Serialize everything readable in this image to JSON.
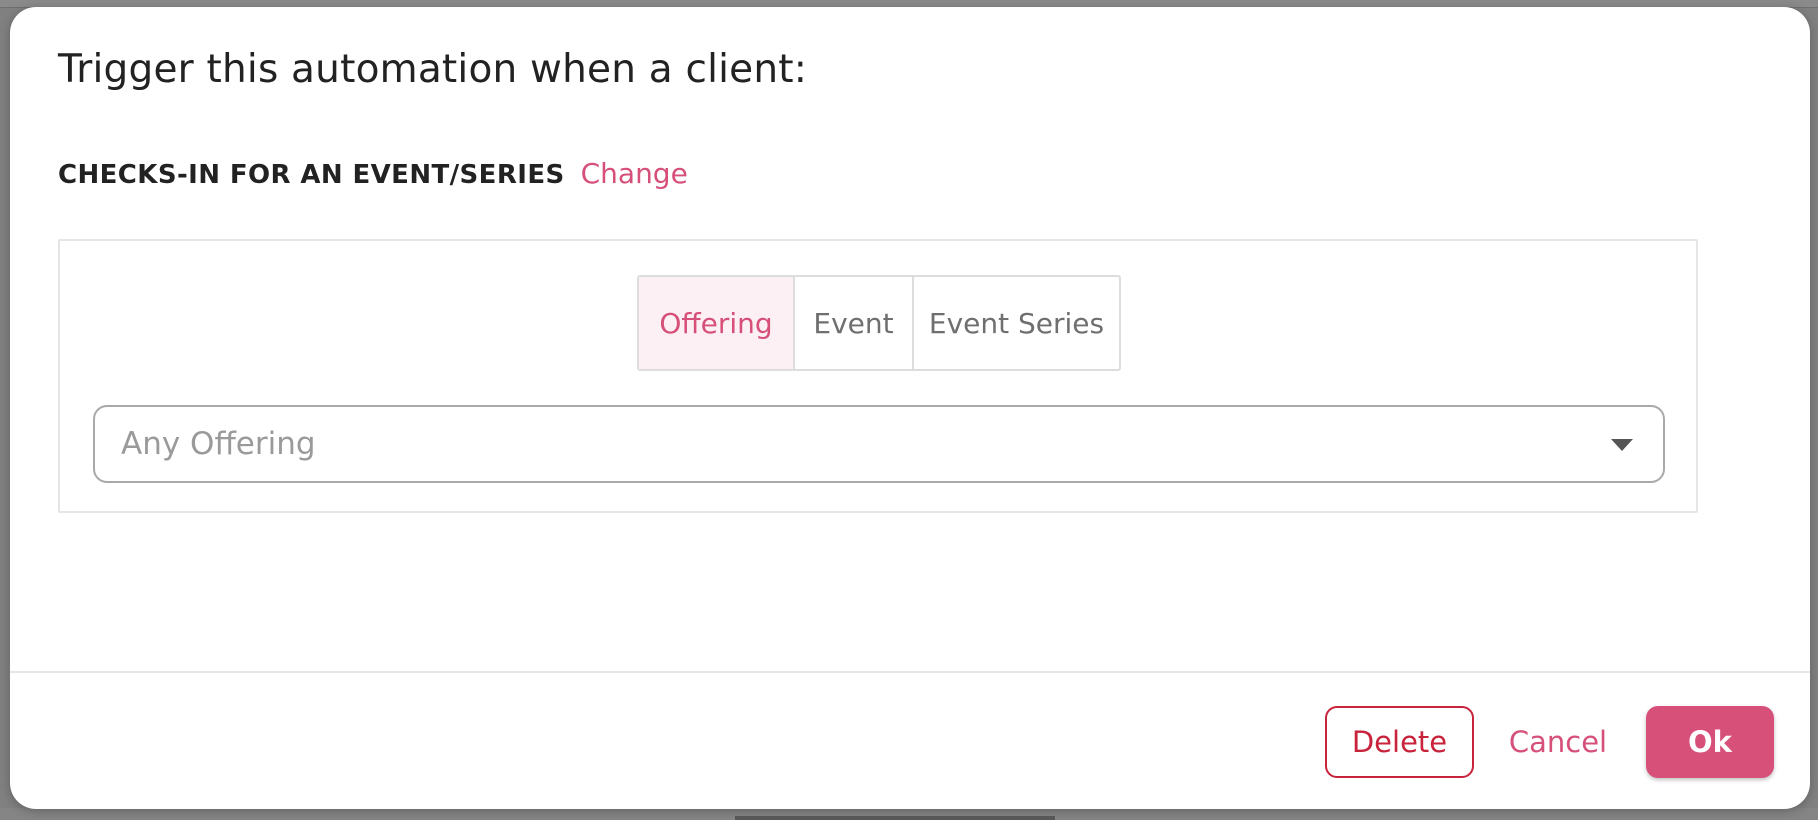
{
  "modal": {
    "title": "Trigger this automation when a client:",
    "trigger_type": "CHECKS-IN FOR AN EVENT/SERIES",
    "change_label": "Change"
  },
  "filter_tabs": {
    "offering": "Offering",
    "event": "Event",
    "event_series": "Event Series",
    "selected": "Offering"
  },
  "select": {
    "value": "Any Offering"
  },
  "footer": {
    "delete_label": "Delete",
    "cancel_label": "Cancel",
    "ok_label": "Ok"
  },
  "colors": {
    "accent": "#d6507a",
    "danger": "#c8233b",
    "active_tab_bg": "#fcf0f4"
  },
  "icons": {
    "select_caret": "chevron-down-icon"
  }
}
